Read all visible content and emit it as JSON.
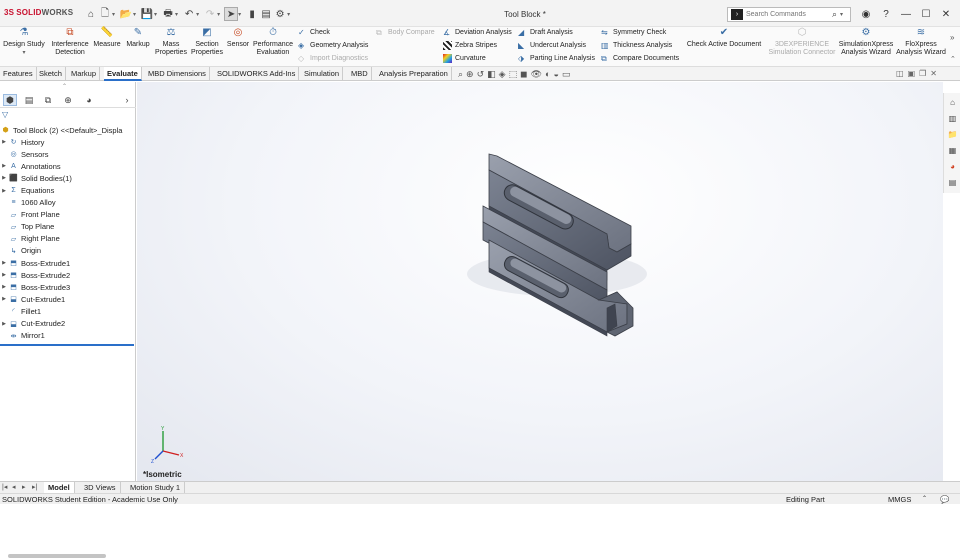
{
  "app": {
    "logo_ds": "3S",
    "logo_brand": "SOLID",
    "logo_works": "WORKS",
    "doc_title": "Tool Block *"
  },
  "search": {
    "placeholder": "Search Commands"
  },
  "ribbon": {
    "large_buttons": [
      {
        "label1": "Design Study",
        "label2": ""
      },
      {
        "label1": "Interference",
        "label2": "Detection"
      },
      {
        "label1": "Measure",
        "label2": ""
      },
      {
        "label1": "Markup",
        "label2": ""
      },
      {
        "label1": "Mass",
        "label2": "Properties"
      },
      {
        "label1": "Section",
        "label2": "Properties"
      },
      {
        "label1": "Sensor",
        "label2": ""
      },
      {
        "label1": "Performance",
        "label2": "Evaluation"
      }
    ],
    "small_col1": [
      "Check",
      "Geometry Analysis",
      "Import Diagnostics"
    ],
    "body_compare": "Body Compare",
    "small_col2": [
      "Deviation Analysis",
      "Zebra Stripes",
      "Curvature"
    ],
    "small_col3": [
      "Draft Analysis",
      "Undercut Analysis",
      "Parting Line Analysis"
    ],
    "small_col4": [
      "Symmetry Check",
      "Thickness Analysis",
      "Compare Documents"
    ],
    "check_active": "Check Active Document",
    "experience1": "3DEXPERIENCE",
    "experience2": "Simulation Connector",
    "simxpress1": "SimulationXpress",
    "simxpress2": "Analysis Wizard",
    "floxpress1": "FloXpress",
    "floxpress2": "Analysis Wizard"
  },
  "tabs": [
    "Features",
    "Sketch",
    "Markup",
    "Evaluate",
    "MBD Dimensions",
    "SOLIDWORKS Add-Ins",
    "Simulation",
    "MBD",
    "Analysis Preparation"
  ],
  "active_tab": "Evaluate",
  "tree": {
    "root": "Tool Block (2) <<Default>_Displa",
    "items": [
      {
        "label": "History",
        "icon": "history-icon",
        "exp": true
      },
      {
        "label": "Sensors",
        "icon": "sensor-icon",
        "exp": false
      },
      {
        "label": "Annotations",
        "icon": "annotation-icon",
        "exp": true
      },
      {
        "label": "Solid Bodies(1)",
        "icon": "solid-bodies-icon",
        "exp": true
      },
      {
        "label": "Equations",
        "icon": "equations-icon",
        "exp": true
      },
      {
        "label": "1060 Alloy",
        "icon": "material-icon",
        "exp": false
      },
      {
        "label": "Front Plane",
        "icon": "plane-icon",
        "exp": false
      },
      {
        "label": "Top Plane",
        "icon": "plane-icon",
        "exp": false
      },
      {
        "label": "Right Plane",
        "icon": "plane-icon",
        "exp": false
      },
      {
        "label": "Origin",
        "icon": "origin-icon",
        "exp": false
      },
      {
        "label": "Boss-Extrude1",
        "icon": "extrude-icon",
        "exp": true
      },
      {
        "label": "Boss-Extrude2",
        "icon": "extrude-icon",
        "exp": true
      },
      {
        "label": "Boss-Extrude3",
        "icon": "extrude-icon",
        "exp": true
      },
      {
        "label": "Cut-Extrude1",
        "icon": "cut-icon",
        "exp": true
      },
      {
        "label": "Fillet1",
        "icon": "fillet-icon",
        "exp": false
      },
      {
        "label": "Cut-Extrude2",
        "icon": "cut-icon",
        "exp": true
      },
      {
        "label": "Mirror1",
        "icon": "mirror-icon",
        "exp": false
      }
    ]
  },
  "viewport": {
    "view_label": "*Isometric"
  },
  "bottom_tabs": [
    "Model",
    "3D Views",
    "Motion Study 1"
  ],
  "status": {
    "left": "SOLIDWORKS Student Edition - Academic Use Only",
    "mode": "Editing Part",
    "units": "MMGS"
  },
  "colors": {
    "accent": "#2a6fc9",
    "brand": "#c8102e"
  }
}
